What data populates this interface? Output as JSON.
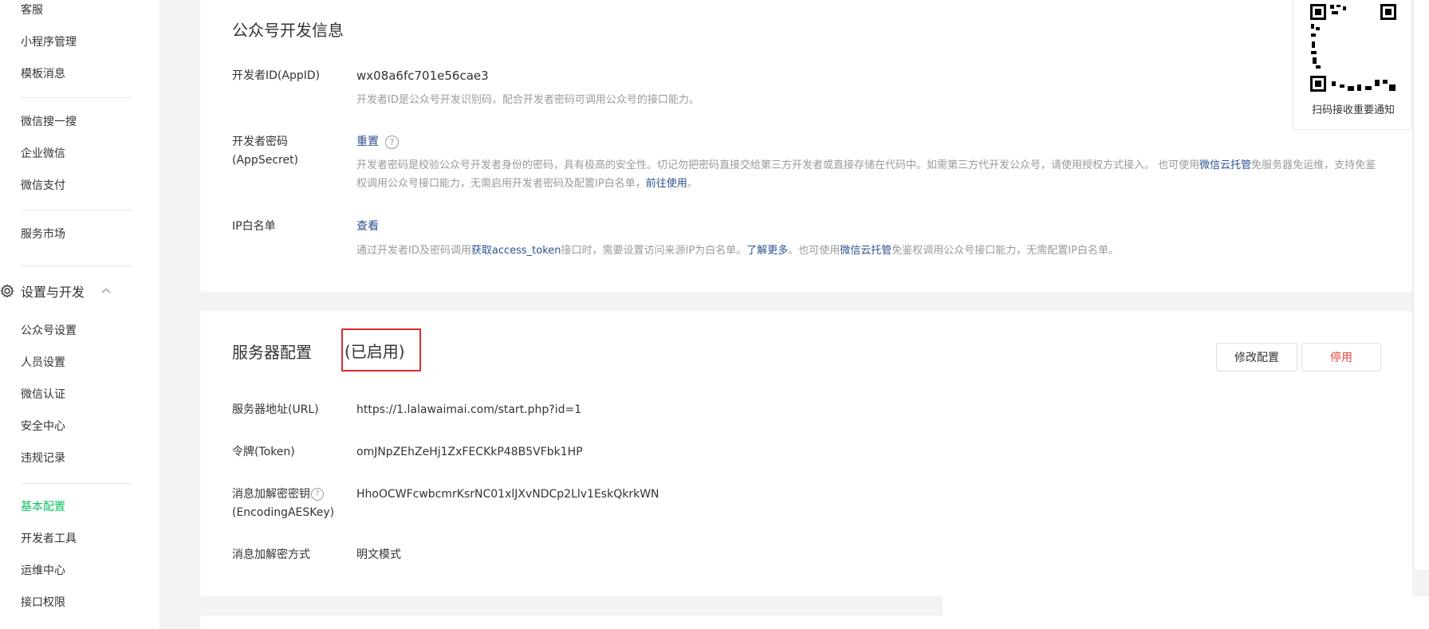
{
  "sidebar": {
    "items_top": [
      "客服",
      "小程序管理",
      "模板消息"
    ],
    "items_mid": [
      "微信搜一搜",
      "企业微信",
      "微信支付"
    ],
    "items_market": [
      "服务市场"
    ],
    "group_title": "设置与开发",
    "items_settings": [
      "公众号设置",
      "人员设置",
      "微信认证",
      "安全中心",
      "违规记录"
    ],
    "items_dev": [
      "基本配置",
      "开发者工具",
      "运维中心",
      "接口权限"
    ],
    "active_item": "基本配置",
    "accent_color": "#07c160"
  },
  "dev_info": {
    "title": "公众号开发信息",
    "appid_label": "开发者ID(AppID)",
    "appid_value": "wx08a6fc701e56cae3",
    "appid_desc": "开发者ID是公众号开发识别码，配合开发者密码可调用公众号的接口能力。",
    "secret_label": "开发者密码(AppSecret)",
    "secret_action": "重置",
    "secret_desc_1": "开发者密码是校验公众号开发者身份的密码，具有极高的安全性。切记勿把密码直接交给第三方开发者或直接存储在代码中。如需第三方代开发公众号，请使用授权方式接入。 也可使用",
    "secret_desc_link1": "微信云托管",
    "secret_desc_2": "免服务器免运维，支持免鉴权调用公众号接口能力，无需启用开发者密码及配置IP白名单，",
    "secret_desc_link2": "前往使用",
    "secret_desc_3": "。",
    "ip_label": "IP白名单",
    "ip_action": "查看",
    "ip_desc_1": "通过开发者ID及密码调用",
    "ip_desc_link1": "获取access_token",
    "ip_desc_2": "接口时，需要设置访问来源IP为白名单。",
    "ip_desc_link2": "了解更多",
    "ip_desc_3": "。也可使用",
    "ip_desc_link3": "微信云托管",
    "ip_desc_4": "免鉴权调用公众号接口能力，无需配置IP白名单。"
  },
  "server_config": {
    "title": "服务器配置",
    "status": "(已启用)",
    "modify_button": "修改配置",
    "disable_button": "停用",
    "url_label": "服务器地址(URL)",
    "url_value": "https://1.lalawaimai.com/start.php?id=1",
    "token_label": "令牌(Token)",
    "token_value": "omJNpZEhZeHj1ZxFECKkP48B5VFbk1HP",
    "aes_label_1": "消息加解密密钥",
    "aes_label_2": "(EncodingAESKey)",
    "aes_value": "HhoOCWFcwbcmrKsrNC01xlJXvNDCp2Llv1EskQkrkWN",
    "mode_label": "消息加解密方式",
    "mode_value": "明文模式",
    "danger_color": "#e64340",
    "highlight_color": "#e12b2b"
  },
  "qr_panel": {
    "caption": "扫码接收重要通知"
  }
}
